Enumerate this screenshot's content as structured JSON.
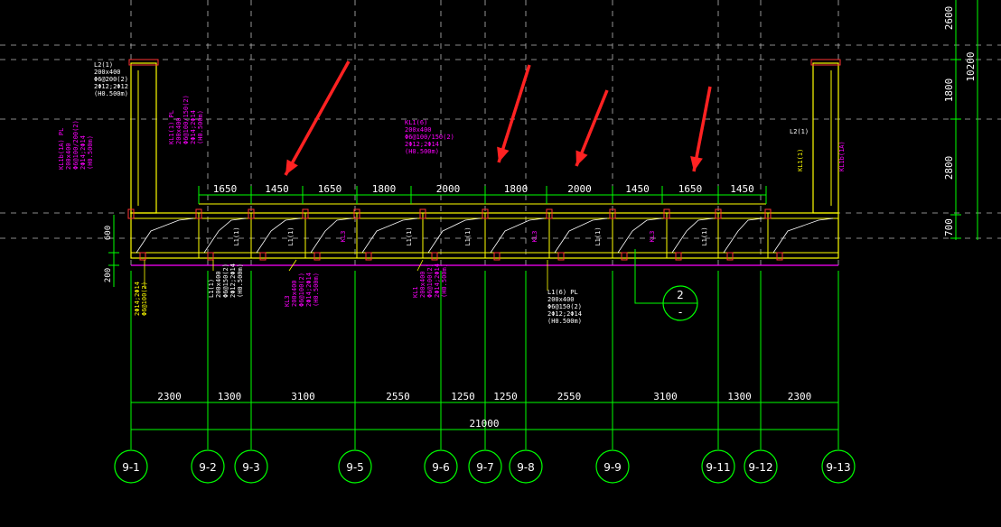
{
  "colors": {
    "background": "#000000",
    "grid": "#b8b8b8",
    "axis": "#00ff00",
    "wall": "#ffff00",
    "beam": "#ff3333",
    "magenta": "#ff00ff",
    "text": "#ffffff",
    "arrow": "#ff2222"
  },
  "top_dims": [
    "1650",
    "1450",
    "1650",
    "1800",
    "2000",
    "1800",
    "2000",
    "1450",
    "1650",
    "1450"
  ],
  "bottom_dims": [
    "2300",
    "1300",
    "3100",
    "2550",
    "1250",
    "1250",
    "2550",
    "3100",
    "1300",
    "2300"
  ],
  "total_dim": "21000",
  "axes": [
    "9-1",
    "9-2",
    "9-3",
    "9-5",
    "9-6",
    "9-7",
    "9-8",
    "9-9",
    "9-11",
    "9-12",
    "9-13"
  ],
  "right_dims": [
    "2600",
    "1800",
    "2800",
    "700"
  ],
  "right_total": "10200",
  "left_dims": [
    "600",
    "200"
  ],
  "section_marker": {
    "number": "2",
    "sub": "-"
  },
  "notes": {
    "top_left": [
      "L2(1)",
      "200x400",
      "Φ6@200(2)",
      "2Φ12;2Φ12",
      "(H0.500m)"
    ],
    "left_magenta": [
      "KL1b(1A) PL",
      "200x400",
      "Φ6@100/200(2)",
      "2Φ14;2Φ14",
      "(H0.500m)"
    ],
    "left_inner": [
      "KL1(1) PL",
      "200x400",
      "Φ6@100/150(2)",
      "2Φ14;2Φ14",
      "(H0.500m)"
    ],
    "top_center": [
      "KL1(6)",
      "200x400",
      "Φ6@100/150(2)",
      "2Φ12;2Φ14",
      "(H0.500m)"
    ],
    "lower_a": [
      "2Φ14;2Φ14",
      "Φ6@100(2)"
    ],
    "lower_b": [
      "L1(1)",
      "200x400",
      "Φ6@150(2)",
      "2Φ12;2Φ14",
      "(H0.500m)"
    ],
    "lower_c": [
      "KL3",
      "200x400",
      "Φ6@100(2)",
      "2Φ14;2Φ14",
      "(H0.500m)"
    ],
    "lower_d": [
      "KL1",
      "200x400",
      "Φ6@100(2)",
      "2Φ14;2Φ14",
      "(H0.500m)"
    ],
    "lower_e": [
      "L1(6) PL",
      "200x400",
      "Φ6@150(2)",
      "2Φ12;2Φ14",
      "(H0.500m)"
    ],
    "right_top": [
      "L2(1)"
    ],
    "right_magenta": [
      "KL1b(1A)"
    ],
    "right_yellow": [
      "KL1(1)"
    ]
  },
  "inline_labels": [
    "L1(1)",
    "L1(1)",
    "KL3",
    "L1(1)",
    "L1(1)",
    "KL3",
    "L1(1)",
    "KL3",
    "L1(1)"
  ]
}
